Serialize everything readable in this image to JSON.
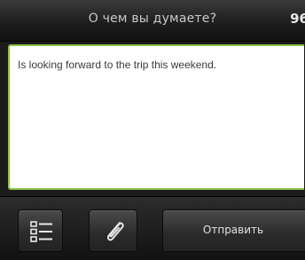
{
  "header": {
    "title": "О чем вы думаете?",
    "counter": "96"
  },
  "editor": {
    "text": "Is looking forward to the trip this weekend."
  },
  "toolbar": {
    "list_icon": "list-icon",
    "attach_icon": "paperclip-icon",
    "send_label": "Отправить"
  },
  "colors": {
    "focus_border": "#8bc34a",
    "background": "#1b1b1b"
  }
}
